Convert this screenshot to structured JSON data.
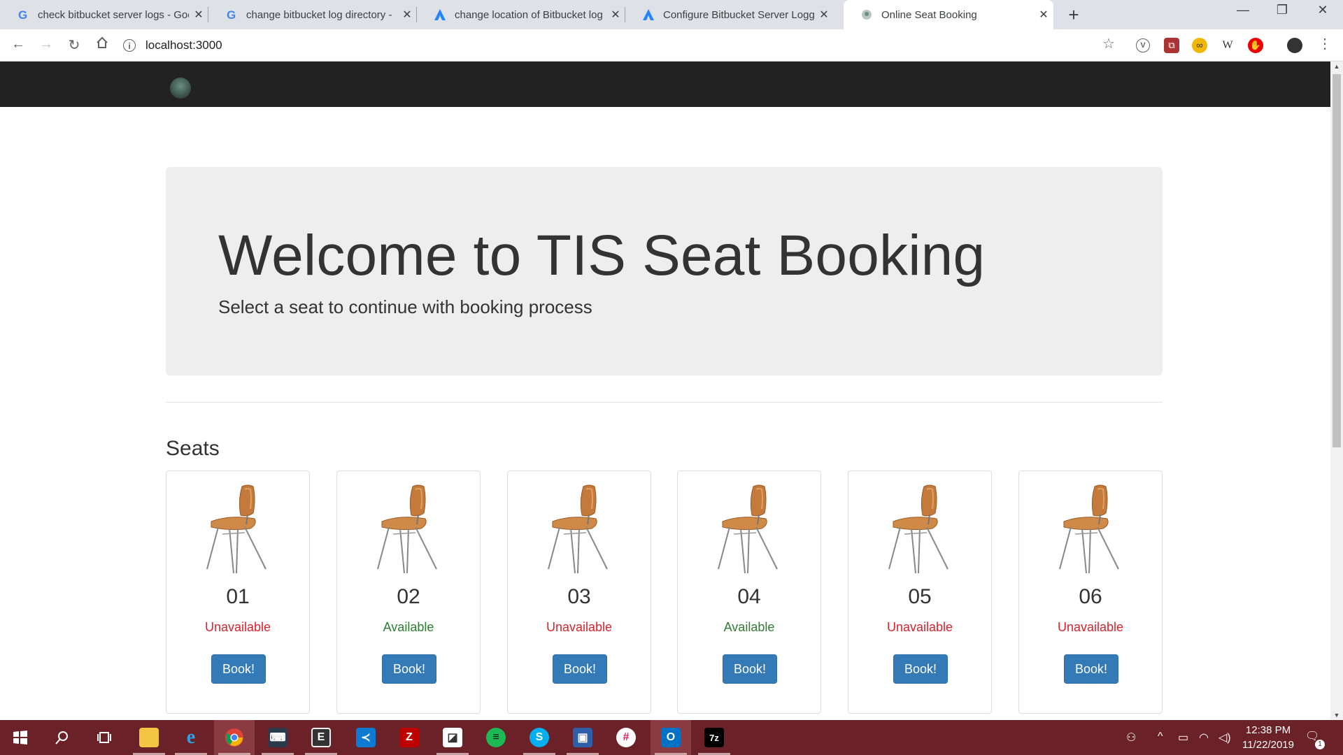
{
  "browser": {
    "tabs": [
      {
        "title": "check bitbucket server logs - Goo",
        "favicon": "google-icon",
        "active": false
      },
      {
        "title": "change bitbucket log directory - ",
        "favicon": "google-icon",
        "active": false
      },
      {
        "title": "change location of Bitbucket log",
        "favicon": "atlassian-icon",
        "active": false
      },
      {
        "title": "Configure Bitbucket Server Loggi",
        "favicon": "atlassian-icon",
        "active": false
      },
      {
        "title": "Online Seat Booking",
        "favicon": "site-icon",
        "active": true
      }
    ],
    "new_tab_symbol": "+",
    "window_controls": {
      "minimize": "—",
      "restore": "❐",
      "close": "✕"
    },
    "url": "localhost:3000",
    "extensions": [
      "vimeo-icon",
      "pdf-icon",
      "glasses-icon",
      "wikipedia-icon",
      "adblock-icon",
      "profile-avatar"
    ]
  },
  "page": {
    "jumbotron": {
      "heading": "Welcome to TIS Seat Booking",
      "subheading": "Select a seat to continue with booking process"
    },
    "section_title": "Seats",
    "seats": [
      {
        "number": "01",
        "status": "Unavailable",
        "button": "Book!"
      },
      {
        "number": "02",
        "status": "Available",
        "button": "Book!"
      },
      {
        "number": "03",
        "status": "Unavailable",
        "button": "Book!"
      },
      {
        "number": "04",
        "status": "Available",
        "button": "Book!"
      },
      {
        "number": "05",
        "status": "Unavailable",
        "button": "Book!"
      },
      {
        "number": "06",
        "status": "Unavailable",
        "button": "Book!"
      }
    ]
  },
  "colors": {
    "navbar": "#222222",
    "jumbotron_bg": "#eeeeee",
    "available": "#2e7d32",
    "unavailable": "#d9232d",
    "button": "#337ab7",
    "taskbar": "#6b2128"
  },
  "taskbar": {
    "apps": [
      "windows-start-icon",
      "search-icon",
      "task-view-icon",
      "file-explorer-icon",
      "internet-explorer-icon",
      "chrome-icon",
      "terminal-icon",
      "editor-icon",
      "vscode-icon",
      "filezilla-icon",
      "sticky-notes-icon",
      "spotify-icon",
      "skype-icon",
      "remote-desktop-icon",
      "slack-icon",
      "outlook-icon",
      "7zip-icon"
    ],
    "clock_time": "12:38 PM",
    "clock_date": "11/22/2019",
    "notification_count": "1"
  }
}
